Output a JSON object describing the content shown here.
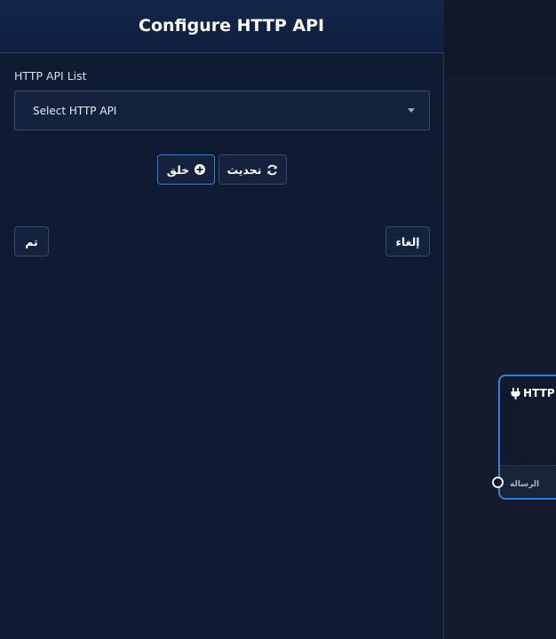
{
  "panel": {
    "title": "Configure HTTP API",
    "field_label": "HTTP API List",
    "select": {
      "value": "Select HTTP API"
    },
    "buttons": {
      "create": "خلق",
      "refresh": "تحديث",
      "done": "تم",
      "cancel": "إلغاء"
    }
  },
  "node": {
    "title": "HTTP A",
    "port_label": "الرسالة"
  },
  "colors": {
    "panel_bg": "#0f1b33",
    "accent": "#2f80d8",
    "border": "#34496d"
  }
}
